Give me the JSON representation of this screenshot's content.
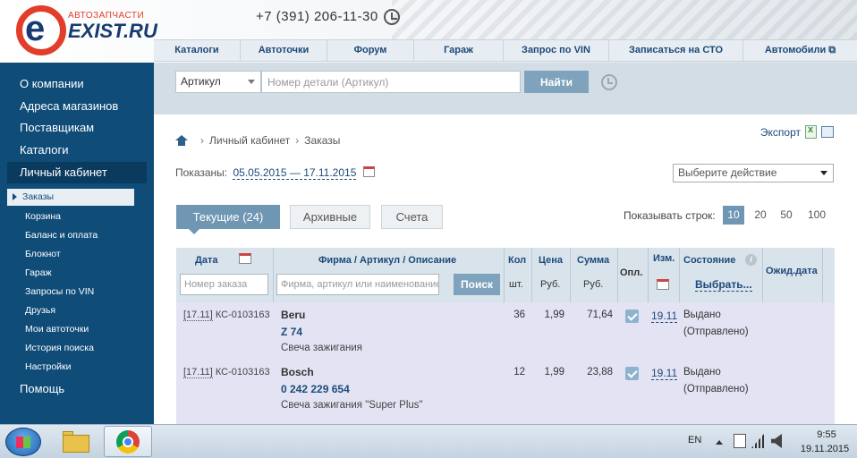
{
  "header": {
    "logo_small": "АВТОЗАПЧАСТИ",
    "logo_big": "EXIST.RU",
    "phone": "+7 (391) 206-11-30"
  },
  "topnav": [
    "Каталоги",
    "Автоточки",
    "Форум",
    "Гараж",
    "Запрос по VIN",
    "Записаться на СТО",
    "Автомобили"
  ],
  "sidebar": {
    "main": [
      "О компании",
      "Адреса магазинов",
      "Поставщикам",
      "Каталоги"
    ],
    "active": "Личный кабинет",
    "sub": [
      "Заказы",
      "Корзина",
      "Баланс и оплата",
      "Блокнот",
      "Гараж",
      "Запросы по VIN",
      "Друзья",
      "Мои автоточки",
      "История поиска",
      "Настройки"
    ],
    "help": "Помощь"
  },
  "search": {
    "type": "Артикул",
    "placeholder": "Номер детали (Артикул)",
    "button": "Найти"
  },
  "breadcrumb": [
    "Личный кабинет",
    "Заказы"
  ],
  "export_label": "Экспорт",
  "shown": {
    "label": "Показаны:",
    "range": "05.05.2015 — 17.11.2015"
  },
  "action_select": "Выберите действие",
  "tabs": {
    "current": "Текущие (24)",
    "archive": "Архивные",
    "bills": "Счета"
  },
  "rows": {
    "label": "Показывать строк:",
    "options": [
      "10",
      "20",
      "50",
      "100"
    ],
    "active": "10"
  },
  "table": {
    "headers": {
      "date": "Дата",
      "firm": "Фирма / Артикул / Описание",
      "qty": "Кол",
      "qty_unit": "шт.",
      "price": "Цена",
      "price_unit": "Руб.",
      "sum": "Сумма",
      "sum_unit": "Руб.",
      "paid": "Опл.",
      "changed": "Изм.",
      "status": "Состояние",
      "status_choose": "Выбрать...",
      "expected": "Ожид.дата"
    },
    "order_placeholder": "Номер заказа",
    "firm_placeholder": "Фирма, артикул или наименование",
    "search_button": "Поиск",
    "rows": [
      {
        "date": "[17.11]",
        "order": "КС-0103163",
        "firm": "Beru",
        "article": "Z 74",
        "desc": "Свеча зажигания",
        "qty": "36",
        "price": "1,99",
        "sum": "71,64",
        "paid": true,
        "changed": "19.11",
        "status1": "Выдано",
        "status2": "(Отправлено)"
      },
      {
        "date": "[17.11]",
        "order": "КС-0103163",
        "firm": "Bosch",
        "article": "0 242 229 654",
        "desc": "Свеча зажигания \"Super Plus\"",
        "qty": "12",
        "price": "1,99",
        "sum": "23,88",
        "paid": true,
        "changed": "19.11",
        "status1": "Выдано",
        "status2": "(Отправлено)"
      }
    ]
  },
  "taskbar": {
    "lang": "EN",
    "time": "9:55",
    "date": "19.11.2015"
  }
}
